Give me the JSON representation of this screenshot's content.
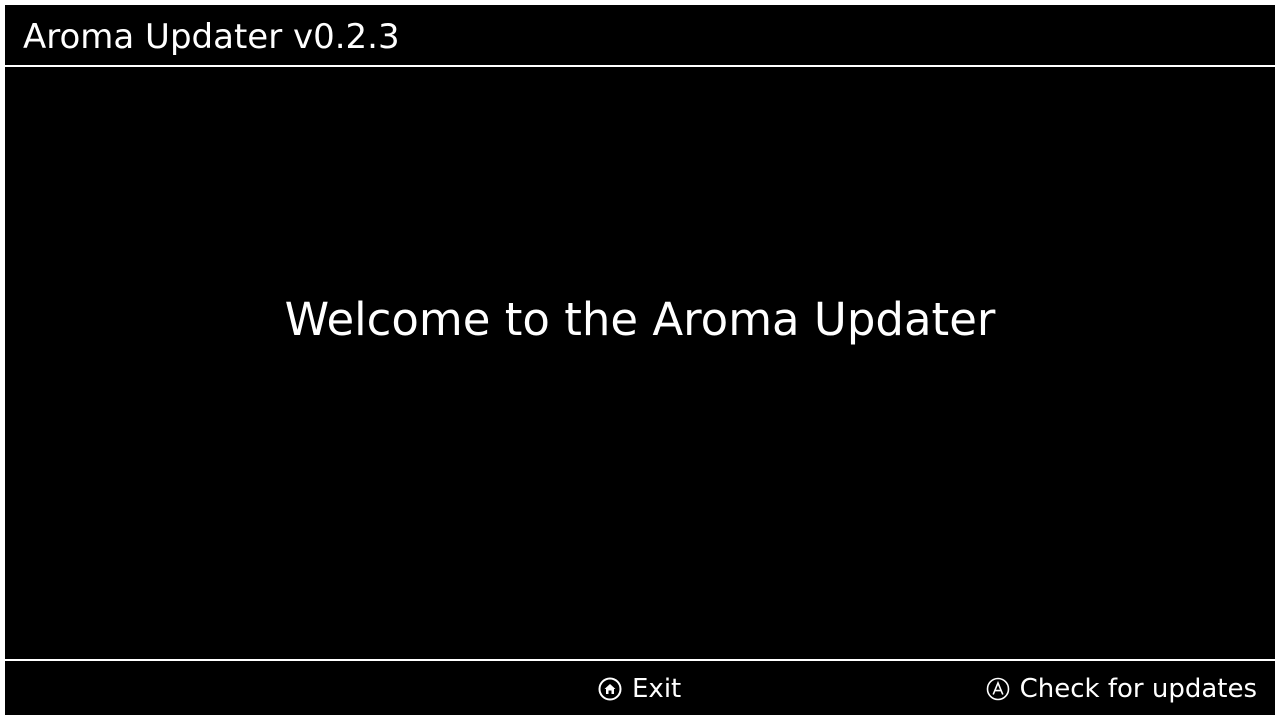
{
  "header": {
    "title": "Aroma Updater v0.2.3"
  },
  "main": {
    "welcome_text": "Welcome to the Aroma Updater"
  },
  "footer": {
    "actions": [
      {
        "icon": "home-button-icon",
        "label": "Exit"
      },
      {
        "icon": "a-button-icon",
        "label": "Check for updates"
      }
    ]
  },
  "colors": {
    "background": "#000000",
    "foreground": "#ffffff"
  }
}
